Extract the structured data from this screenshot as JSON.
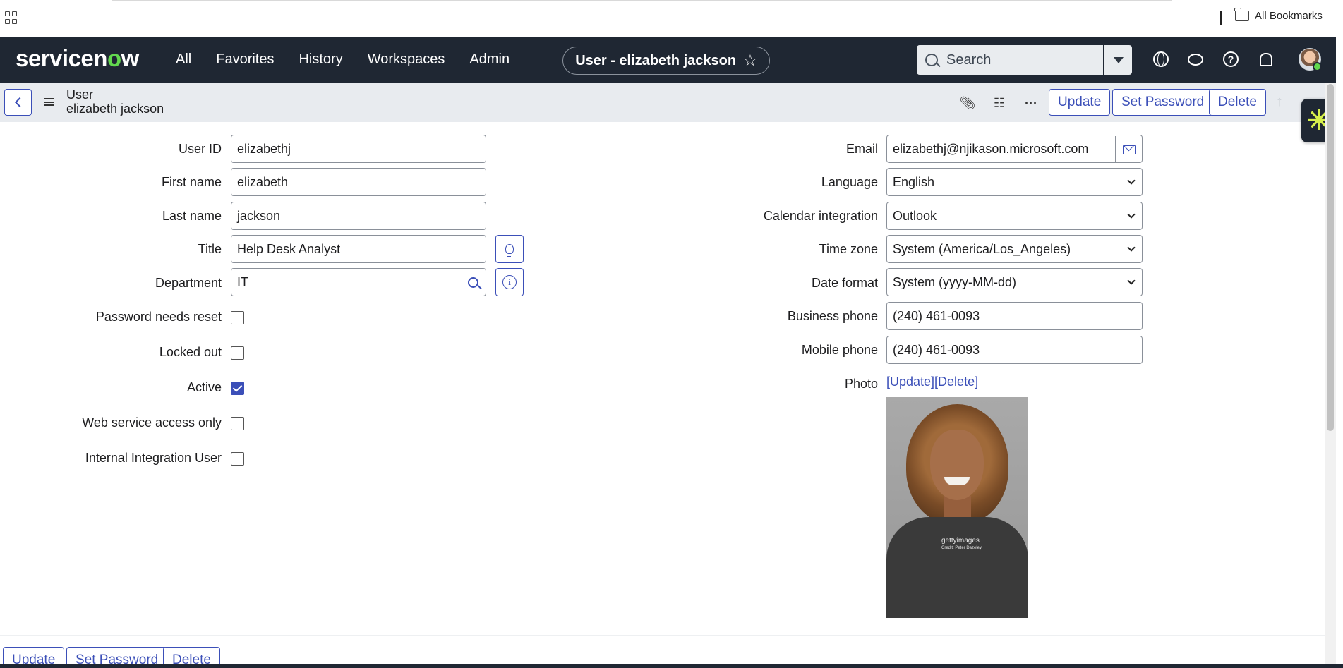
{
  "browser": {
    "bookmarks_label": "All Bookmarks",
    "apps_icon": "apps-grid-icon",
    "folder_icon": "folder-icon"
  },
  "header": {
    "logo_before": "servicen",
    "logo_o": "o",
    "logo_after": "w",
    "nav": [
      "All",
      "Favorites",
      "History",
      "Workspaces",
      "Admin"
    ],
    "context_title": "User - elizabeth jackson",
    "search_placeholder": "Search",
    "help_glyph": "?",
    "icons": [
      "globe-icon",
      "chat-icon",
      "help-icon",
      "bell-icon",
      "avatar"
    ]
  },
  "form": {
    "record_type": "User",
    "record_name": "elizabeth jackson",
    "more_glyph": "···",
    "buttons": {
      "update": "Update",
      "set_password": "Set Password",
      "delete": "Delete"
    },
    "up_glyph": "↑",
    "side_badge_glyph": "✳"
  },
  "left_fields": {
    "user_id": {
      "label": "User ID",
      "value": "elizabethj"
    },
    "first_name": {
      "label": "First name",
      "value": "elizabeth"
    },
    "last_name": {
      "label": "Last name",
      "value": "jackson"
    },
    "title": {
      "label": "Title",
      "value": "Help Desk Analyst"
    },
    "department": {
      "label": "Department",
      "value": "IT"
    },
    "password_needs_reset": {
      "label": "Password needs reset",
      "checked": false
    },
    "locked_out": {
      "label": "Locked out",
      "checked": false
    },
    "active": {
      "label": "Active",
      "checked": true
    },
    "web_service_access_only": {
      "label": "Web service access only",
      "checked": false
    },
    "internal_integration_user": {
      "label": "Internal Integration User",
      "checked": false
    }
  },
  "right_fields": {
    "email": {
      "label": "Email",
      "value": "elizabethj@njikason.microsoft.com"
    },
    "language": {
      "label": "Language",
      "value": "English"
    },
    "calendar_integration": {
      "label": "Calendar integration",
      "value": "Outlook"
    },
    "time_zone": {
      "label": "Time zone",
      "value": "System (America/Los_Angeles)"
    },
    "date_format": {
      "label": "Date format",
      "value": "System (yyyy-MM-dd)"
    },
    "business_phone": {
      "label": "Business phone",
      "value": "(240) 461-0093"
    },
    "mobile_phone": {
      "label": "Mobile phone",
      "value": "(240) 461-0093"
    },
    "photo": {
      "label": "Photo",
      "update_link": "[Update]",
      "delete_link": "[Delete]",
      "watermark": "gettyimages",
      "credit": "Credit: Peter Dazeley"
    }
  },
  "colors": {
    "header_bg": "#1f2733",
    "accent": "#3b4fb8",
    "logo_o": "#62d84e",
    "form_bar_bg": "#e8ebef"
  }
}
